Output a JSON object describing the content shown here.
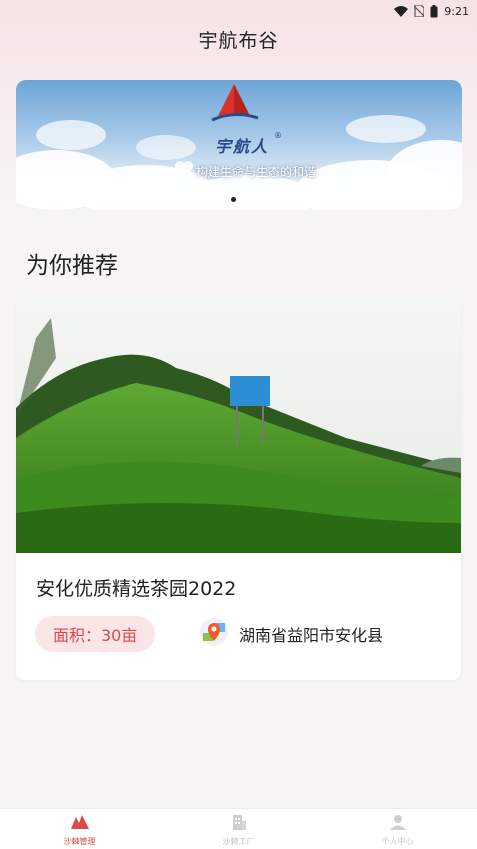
{
  "status_bar": {
    "time": "9:21",
    "icons": [
      "wifi-icon",
      "no-sim-icon",
      "battery-icon"
    ]
  },
  "app": {
    "title": "宇航布谷"
  },
  "banner": {
    "brand": "宇航人",
    "registered_mark": "®",
    "slogan": "构建生命与生态的和谐",
    "slide_count": 2,
    "active_slide": 1
  },
  "section": {
    "title": "为你推荐"
  },
  "card": {
    "title": "安化优质精选茶园2022",
    "area": "面积：30亩",
    "location": "湖南省益阳市安化县",
    "icons": [
      "tea-garden-photo",
      "location-pin-icon"
    ]
  },
  "tabbar": {
    "items": [
      {
        "label": "沙棘管理",
        "icon": "sea-buckthorn-icon",
        "active": true
      },
      {
        "label": "沙棘工厂",
        "icon": "factory-icon",
        "active": false
      },
      {
        "label": "个人中心",
        "icon": "person-icon",
        "active": false
      }
    ]
  },
  "colors": {
    "accent": "#e04848",
    "badge_bg": "#fbe6e7",
    "header_bg": "#f6e3e4"
  }
}
